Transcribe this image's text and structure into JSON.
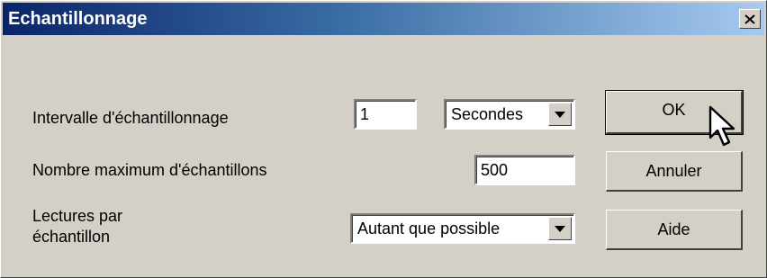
{
  "window": {
    "title": "Echantillonnage"
  },
  "title_buttons": {
    "close": "close-icon"
  },
  "form": {
    "interval_label": "Intervalle d'échantillonnage",
    "interval_value": "1",
    "interval_unit": "Secondes",
    "max_samples_label": "Nombre maximum d'échantillons",
    "max_samples_value": "500",
    "readings_label_line1": "Lectures par",
    "readings_label_line2": "échantillon",
    "readings_value": "Autant que possible"
  },
  "buttons": {
    "ok": "OK",
    "cancel": "Annuler",
    "help": "Aide"
  },
  "colors": {
    "face": "#d4d0c8",
    "title_start": "#0a246a",
    "title_end": "#a6caf0"
  },
  "icons": {
    "pointer": "arrow-cursor-icon",
    "dropdown": "chevron-down-icon"
  }
}
